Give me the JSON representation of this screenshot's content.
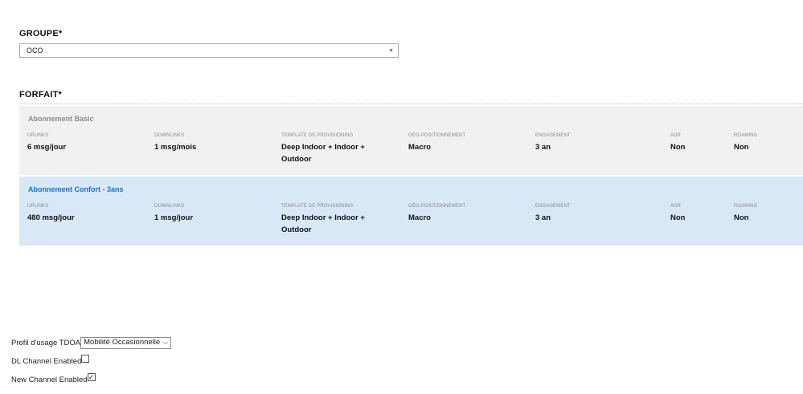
{
  "groupe": {
    "label": "GROUPE*",
    "selected": "OCO"
  },
  "forfait": {
    "label": "FORFAIT*",
    "columns": [
      "UPLINKS",
      "DOWNLINKS",
      "TEMPLATE DE PROVISIONING",
      "GÉO-POSITIONNEMENT",
      "ENGAGEMENT",
      "ADR",
      "ROAMING"
    ],
    "plans": [
      {
        "name": "Abonnement Basic",
        "uplinks": "6 msg/jour",
        "downlinks": "1 msg/mois",
        "template": "Deep Indoor + Indoor + Outdoor",
        "geo": "Macro",
        "engagement": "3 an",
        "adr": "Non",
        "roaming": "Non",
        "selected": false
      },
      {
        "name": "Abonnement Confort - 3ans",
        "uplinks": "480 msg/jour",
        "downlinks": "1 msg/jour",
        "template": "Deep Indoor + Indoor + Outdoor",
        "geo": "Macro",
        "engagement": "3 an",
        "adr": "Non",
        "roaming": "Non",
        "selected": true
      }
    ]
  },
  "tdoa": {
    "label": "Profil d'usage TDOA",
    "selected": "Mobilité Occasionnelle"
  },
  "dl_channel": {
    "label": "DL Channel Enabled",
    "checked": false
  },
  "new_channel": {
    "label": "New Channel Enabled",
    "checked": true
  }
}
